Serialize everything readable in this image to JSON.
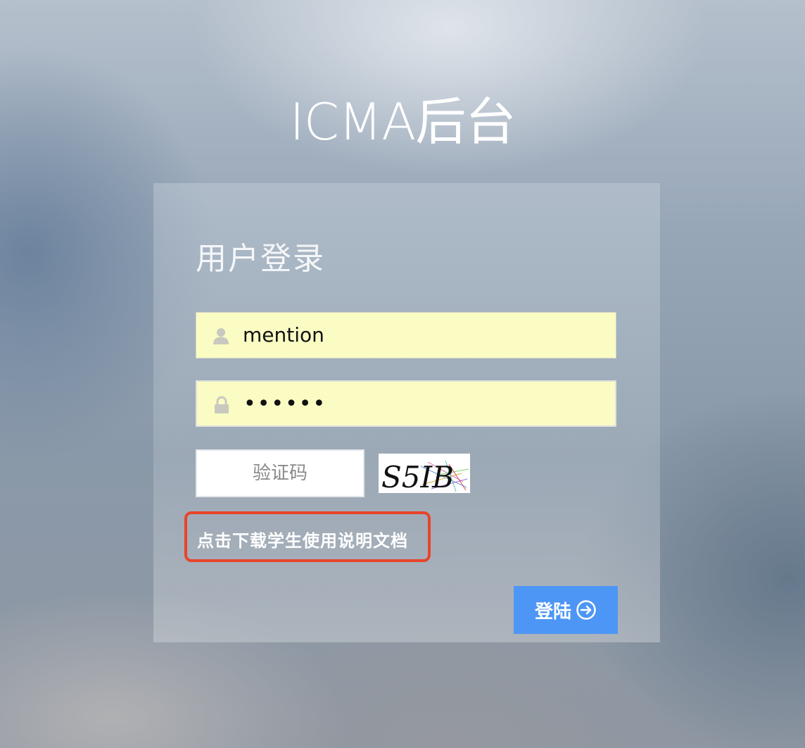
{
  "page": {
    "title": "ICMA后台"
  },
  "login_panel": {
    "heading": "用户登录",
    "username": {
      "value": "mention",
      "icon": "user-icon"
    },
    "password": {
      "value": "••••••",
      "icon": "lock-icon"
    },
    "captcha": {
      "placeholder": "验证码",
      "value": "",
      "image_text": "S5IB"
    },
    "download_link": {
      "label": "点击下载学生使用说明文档"
    },
    "login_button": {
      "label": "登陆",
      "icon": "arrow-right-circle-icon"
    }
  },
  "colors": {
    "button_blue": "#4d96f5",
    "highlight_red": "#e8442a",
    "autofill_yellow": "#fafcc4"
  }
}
